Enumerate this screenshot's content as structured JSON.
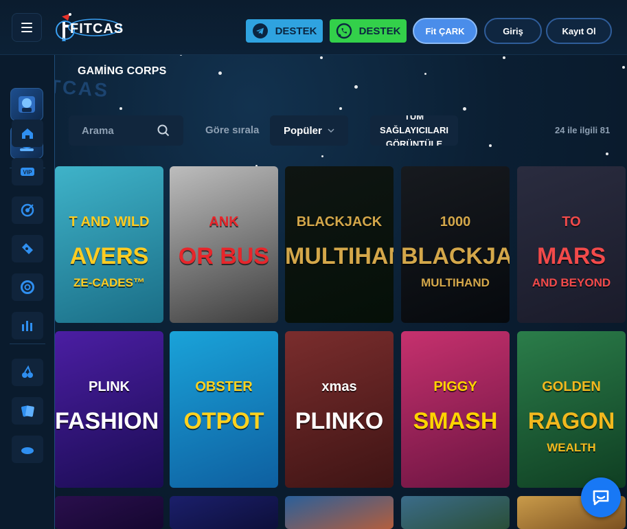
{
  "header": {
    "logo_text": "FITCAS",
    "telegram_label": "DESTEK",
    "whatsapp_label": "DESTEK",
    "fit_cark_label": "Fit ÇARK",
    "login_label": "Giriş",
    "register_label": "Kayıt Ol"
  },
  "sidebar": {
    "items": [
      {
        "icon": "home-icon"
      },
      {
        "icon": "vip-icon"
      },
      {
        "icon": "target-icon"
      },
      {
        "icon": "ticket-icon"
      },
      {
        "icon": "lifebuoy-icon"
      },
      {
        "icon": "chart-icon"
      },
      {
        "icon": "cherry-icon"
      },
      {
        "icon": "cards-icon"
      }
    ],
    "vip_badge": "VIP"
  },
  "background_watermark": "FITCAS",
  "provider": {
    "title": "GAMİNG CORPS"
  },
  "filters": {
    "search_placeholder": "Arama",
    "sort_label": "Göre sırala",
    "sort_value": "Popüler",
    "all_providers_label": "TÜM SAĞLAYICILARI GÖRÜNTÜLE",
    "result_count": "24 ile ilgili 81"
  },
  "games": [
    {
      "line1": "T AND WILD",
      "line2": "AVERS",
      "line3": "ZE-CADES™",
      "colors": [
        "#3fb3c9",
        "#1a6d86"
      ],
      "accent": "#ffcc22"
    },
    {
      "line1": "ANK",
      "line2": "OR BUS",
      "line3": "",
      "colors": [
        "#bdbdbd",
        "#3d3d3d"
      ],
      "accent": "#e7262b"
    },
    {
      "line1": "BLACKJACK",
      "line2": "MULTIHAND",
      "line3": "",
      "colors": [
        "#0f1512",
        "#051008"
      ],
      "accent": "#d4a74a"
    },
    {
      "line1": "1000",
      "line2": "BLACKJACK",
      "line3": "MULTIHAND",
      "colors": [
        "#171a1f",
        "#06090d"
      ],
      "accent": "#d4a74a"
    },
    {
      "line1": "TO",
      "line2": "MARS",
      "line3": "AND BEYOND",
      "colors": [
        "#2a2c3f",
        "#1a1b2a"
      ],
      "accent": "#f24a4a"
    },
    {
      "line1": "PLINK",
      "line2": "FASHION TV",
      "line3": "",
      "colors": [
        "#4b1ea3",
        "#1a0c52"
      ],
      "accent": "#ffffff"
    },
    {
      "line1": "OBSTER",
      "line2": "OTPOT",
      "line3": "",
      "colors": [
        "#1aa3d9",
        "#0e5fa0"
      ],
      "accent": "#ffd21f"
    },
    {
      "line1": "xmas",
      "line2": "PLINKO",
      "line3": "",
      "colors": [
        "#7a2d2d",
        "#3e1414"
      ],
      "accent": "#ffffff"
    },
    {
      "line1": "PIGGY",
      "line2": "SMASH",
      "line3": "",
      "colors": [
        "#c6316e",
        "#6b1441"
      ],
      "accent": "#ffd400"
    },
    {
      "line1": "GOLDEN",
      "line2": "RAGON",
      "line3": "WEALTH",
      "colors": [
        "#2b7d4a",
        "#0f3e22"
      ],
      "accent": "#f2b81e"
    },
    {
      "line1": "",
      "line2": "",
      "line3": "",
      "colors": [
        "#2a0f4d",
        "#150730"
      ],
      "accent": "#ff3db5"
    },
    {
      "line1": "",
      "line2": "",
      "line3": "",
      "colors": [
        "#1b1f6b",
        "#0d0f3a"
      ],
      "accent": "#e03a2a"
    },
    {
      "line1": "",
      "line2": "",
      "line3": "",
      "colors": [
        "#2a5f9a",
        "#b35e3d"
      ],
      "accent": "#ff8fd1"
    },
    {
      "line1": "",
      "line2": "",
      "line3": "",
      "colors": [
        "#3b6c8a",
        "#2a4f38"
      ],
      "accent": "#ffffff"
    },
    {
      "line1": "",
      "line2": "",
      "line3": "",
      "colors": [
        "#c99b4a",
        "#7b5020"
      ],
      "accent": "#ffd95a"
    }
  ],
  "chat": {
    "icon": "chat-icon"
  }
}
